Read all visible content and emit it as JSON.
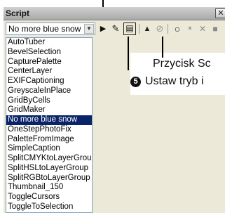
{
  "palette": {
    "title": "Script",
    "close_glyph": "✕",
    "combo": {
      "selected": "No more blue snow",
      "arrow_glyph": "▼"
    },
    "toolbar": {
      "run": "▶",
      "edit": "✎",
      "interactive": "▤",
      "record": "▲",
      "cancel": "⊘",
      "record_start": "○",
      "pause": "⏸",
      "stop_cancel": "✕",
      "stop": "■"
    },
    "scripts": [
      "AutoTuber",
      "BevelSelection",
      "CapturePalette",
      "CenterLayer",
      "EXIFCaptioning",
      "GreyscaleInPlace",
      "GridByCells",
      "GridMaker",
      "No more blue snow",
      "OneStepPhotoFix",
      "PaletteFromImage",
      "SimpleCaption",
      "SplitCMYKtoLayerGroup",
      "SplitHSLtoLayerGroup",
      "SplitRGBtoLayerGroup",
      "Thumbnail_150",
      "ToggleCursors",
      "ToggleToSelection"
    ],
    "selected_index": 8
  },
  "annotations": {
    "callout_1": "Przycisk Sc",
    "callout_2_number": "5",
    "callout_2": "Ustaw tryb i"
  },
  "colors": {
    "selection": "#0a246a",
    "panel": "#ece9d8"
  }
}
